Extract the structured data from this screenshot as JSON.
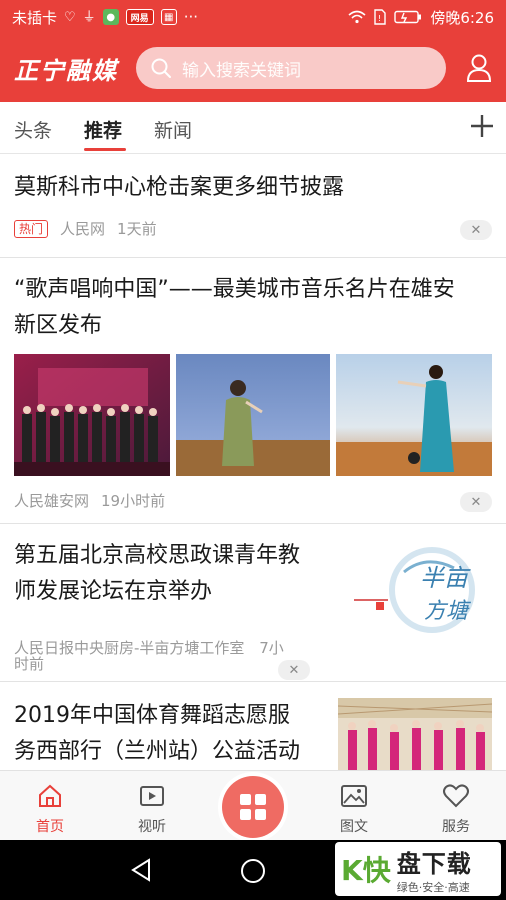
{
  "status_bar": {
    "carrier": "未插卡",
    "badge_text": "网易",
    "more": "···",
    "time_label": "傍晚6:26"
  },
  "header": {
    "logo": "正宁融媒",
    "search_placeholder": "输入搜索关键词"
  },
  "tabs": [
    {
      "label": "头条"
    },
    {
      "label": "推荐",
      "active": true
    },
    {
      "label": "新闻"
    }
  ],
  "articles": [
    {
      "title": "莫斯科市中心枪击案更多细节披露",
      "tag": "热门",
      "source": "人民网",
      "time": "1天前"
    },
    {
      "title_line1": "“歌声唱响中国”——最美城市音乐名片在雄安",
      "title_line2": "新区发布",
      "source": "人民雄安网",
      "time": "19小时前"
    },
    {
      "title_line1": "第五届北京高校思政课青年教",
      "title_line2": "师发展论坛在京举办",
      "source_line1": "人民日报中央厨房-半亩方塘工作室",
      "source_line2": "7小",
      "source_line3": "时前",
      "logo_text": "半亩方塘"
    },
    {
      "title_line1": "2019年中国体育舞蹈志愿服",
      "title_line2": "务西部行（兰州站）公益活动"
    }
  ],
  "bottom_nav": [
    {
      "label": "首页",
      "icon": "home-icon",
      "active": true
    },
    {
      "label": "视听",
      "icon": "video-icon"
    },
    {
      "label": "",
      "icon": "grid-icon"
    },
    {
      "label": "图文",
      "icon": "image-icon"
    },
    {
      "label": "服务",
      "icon": "heart-icon"
    }
  ],
  "watermark": {
    "logo": "K快",
    "title": "盘下载",
    "subtitle": "绿色·安全·高速"
  },
  "colors": {
    "brand_red": "#e8403a"
  }
}
